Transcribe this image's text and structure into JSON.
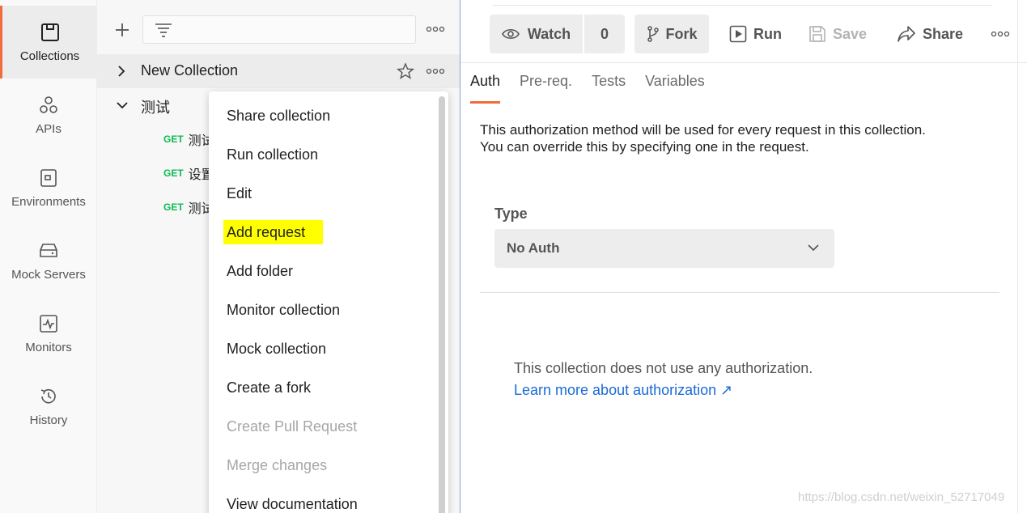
{
  "nav": {
    "items": [
      {
        "label": "Collections",
        "icon": "collections-icon"
      },
      {
        "label": "APIs",
        "icon": "apis-icon"
      },
      {
        "label": "Environments",
        "icon": "environments-icon"
      },
      {
        "label": "Mock Servers",
        "icon": "mock-servers-icon"
      },
      {
        "label": "Monitors",
        "icon": "monitors-icon"
      },
      {
        "label": "History",
        "icon": "history-icon"
      }
    ]
  },
  "panel": {
    "filter_placeholder": "",
    "collections": [
      {
        "name": "New Collection"
      },
      {
        "name": "测试"
      }
    ],
    "requests": [
      {
        "method": "GET",
        "name": "测试"
      },
      {
        "method": "GET",
        "name": "设置"
      },
      {
        "method": "GET",
        "name": "测试"
      }
    ]
  },
  "menu": {
    "items": [
      {
        "label": "Share collection",
        "disabled": false
      },
      {
        "label": "Run collection",
        "disabled": false
      },
      {
        "label": "Edit",
        "disabled": false
      },
      {
        "label": "Add request",
        "disabled": false,
        "highlighted": true
      },
      {
        "label": "Add folder",
        "disabled": false
      },
      {
        "label": "Monitor collection",
        "disabled": false
      },
      {
        "label": "Mock collection",
        "disabled": false
      },
      {
        "label": "Create a fork",
        "disabled": false
      },
      {
        "label": "Create Pull Request",
        "disabled": true
      },
      {
        "label": "Merge changes",
        "disabled": true
      },
      {
        "label": "View documentation",
        "disabled": false
      }
    ]
  },
  "toolbar": {
    "watch_label": "Watch",
    "watch_count": "0",
    "fork_label": "Fork",
    "run_label": "Run",
    "save_label": "Save",
    "share_label": "Share"
  },
  "tabs": [
    "Auth",
    "Pre-req.",
    "Tests",
    "Variables"
  ],
  "auth": {
    "description_line1": "This authorization method will be used for every request in this collection.",
    "description_line2": "You can override this by specifying one in the request.",
    "type_label": "Type",
    "type_value": "No Auth",
    "no_auth_text": "This collection does not use any authorization.",
    "learn_more": "Learn more about authorization ↗"
  },
  "watermark": "https://blog.csdn.net/weixin_52717049",
  "colors": {
    "accent": "#f26b3a",
    "get_method": "#0cbb52",
    "link": "#1a6bd6",
    "highlight": "#ffff00"
  }
}
